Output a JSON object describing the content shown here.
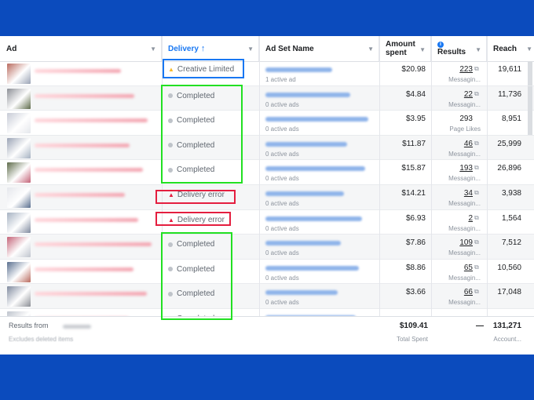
{
  "columns": {
    "ad": "Ad",
    "delivery": "Delivery",
    "delivery_sort_icon": "arrow-up-icon",
    "ad_set_name": "Ad Set Name",
    "amount_spent_line1": "Amount",
    "amount_spent_line2": "spent",
    "results": "Results",
    "results_info_icon": "info-icon",
    "reach": "Reach"
  },
  "rows": [
    {
      "delivery": "Creative Limited",
      "status": "limited",
      "adset_sub": "1 active ad",
      "spent": "$20.98",
      "result": "223",
      "result_label": "Messagin...",
      "reach": "19,611"
    },
    {
      "delivery": "Completed",
      "status": "completed",
      "adset_sub": "0 active ads",
      "spent": "$4.84",
      "result": "22",
      "result_label": "Messagin...",
      "reach": "11,736"
    },
    {
      "delivery": "Completed",
      "status": "completed",
      "adset_sub": "0 active ads",
      "spent": "$3.95",
      "result": "293",
      "result_label": "Page Likes",
      "reach": "8,951"
    },
    {
      "delivery": "Completed",
      "status": "completed",
      "adset_sub": "0 active ads",
      "spent": "$11.87",
      "result": "46",
      "result_label": "Messagin...",
      "reach": "25,999"
    },
    {
      "delivery": "Completed",
      "status": "completed",
      "adset_sub": "0 active ads",
      "spent": "$15.87",
      "result": "193",
      "result_label": "Messagin...",
      "reach": "26,896"
    },
    {
      "delivery": "Delivery error",
      "status": "error",
      "adset_sub": "0 active ads",
      "spent": "$14.21",
      "result": "34",
      "result_label": "Messagin...",
      "reach": "3,938"
    },
    {
      "delivery": "Delivery error",
      "status": "error",
      "adset_sub": "0 active ads",
      "spent": "$6.93",
      "result": "2",
      "result_label": "Messagin...",
      "reach": "1,564"
    },
    {
      "delivery": "Completed",
      "status": "completed",
      "adset_sub": "0 active ads",
      "spent": "$7.86",
      "result": "109",
      "result_label": "Messagin...",
      "reach": "7,512"
    },
    {
      "delivery": "Completed",
      "status": "completed",
      "adset_sub": "0 active ads",
      "spent": "$8.86",
      "result": "65",
      "result_label": "Messagin...",
      "reach": "10,560"
    },
    {
      "delivery": "Completed",
      "status": "completed",
      "adset_sub": "0 active ads",
      "spent": "$3.66",
      "result": "66",
      "result_label": "Messagin...",
      "reach": "17,048"
    },
    {
      "delivery": "Completed",
      "status": "completed",
      "adset_sub": "",
      "spent": "",
      "result": "",
      "result_label": "",
      "reach": ""
    }
  ],
  "footer": {
    "results_from": "Results from",
    "excludes": "Excludes deleted items",
    "total_spent": "$109.41",
    "total_spent_label": "Total Spent",
    "results_total": "—",
    "reach_total": "131,271",
    "reach_label": "Account..."
  },
  "colors": {
    "accent": "#1877f2",
    "limited_triangle": "#f7b928",
    "error_triangle": "#e41e3f",
    "highlight_blue": "#1877f2",
    "highlight_red": "#e41e3f",
    "highlight_green": "#22e022",
    "background_band": "#0b4bbd"
  }
}
